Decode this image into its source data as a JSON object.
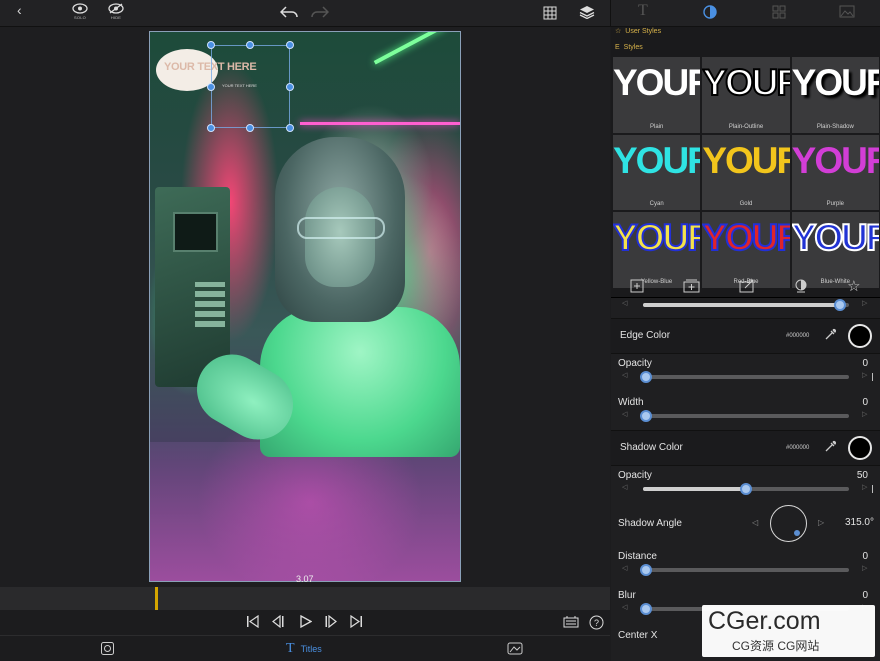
{
  "toolbar": {
    "solo_caption": "SOLO",
    "hide_caption": "HIDE",
    "icons": [
      "back-chevron-icon",
      "solo-eye-icon",
      "hide-eye-icon",
      "undo-icon",
      "redo-icon",
      "grid-icon",
      "layers-icon",
      "text-style-icon",
      "appearance-icon",
      "arrange-icon",
      "image-icon"
    ]
  },
  "canvas": {
    "title_placeholder": "YOUR TEXT HERE",
    "subtitle_placeholder": "YOUR TEXT HERE",
    "timecode": "3.07"
  },
  "bottom_bar": {
    "titles_label": "Titles"
  },
  "styles_panel": {
    "user_styles_label": "User Styles",
    "styles_label": "Styles",
    "sample_word": "YOUR",
    "presets": [
      {
        "name": "Plain",
        "fill": "#ffffff",
        "outline": "",
        "shadow": ""
      },
      {
        "name": "Plain-Outline",
        "fill": "#ffffff",
        "outline": "#000000",
        "shadow": ""
      },
      {
        "name": "Plain-Shadow",
        "fill": "#ffffff",
        "outline": "",
        "shadow": "#000000"
      },
      {
        "name": "Cyan",
        "fill": "#2fe3e3",
        "outline": "",
        "shadow": ""
      },
      {
        "name": "Gold",
        "fill": "#f2c51c",
        "outline": "",
        "shadow": ""
      },
      {
        "name": "Purple",
        "fill": "#d23ed6",
        "outline": "",
        "shadow": ""
      },
      {
        "name": "Yellow-Blue",
        "fill": "#f4e24a",
        "outline": "#2230d8",
        "shadow": ""
      },
      {
        "name": "Red-Blue",
        "fill": "#e0242a",
        "outline": "#2230d8",
        "shadow": ""
      },
      {
        "name": "Blue-White",
        "fill": "#2133d4",
        "outline": "#ffffff",
        "shadow": ""
      }
    ]
  },
  "properties": {
    "top_slider_value": 0.97,
    "edge_color_label": "Edge Color",
    "edge_color_hex": "#000000",
    "edge_opacity_label": "Opacity",
    "edge_opacity_value": "0",
    "edge_opacity_fraction": 0.0,
    "width_label": "Width",
    "width_value": "0",
    "width_fraction": 0.0,
    "shadow_color_label": "Shadow Color",
    "shadow_color_hex": "#000000",
    "shadow_opacity_label": "Opacity",
    "shadow_opacity_value": "50",
    "shadow_opacity_fraction": 0.5,
    "shadow_angle_label": "Shadow Angle",
    "shadow_angle_value": "315.0°",
    "distance_label": "Distance",
    "distance_value": "0",
    "distance_fraction": 0.0,
    "blur_label": "Blur",
    "blur_value": "0",
    "blur_fraction": 0.0,
    "center_x_label": "Center X"
  },
  "watermark": {
    "main": "CGer.com",
    "sub": "CG资源 CG网站"
  },
  "colors": {
    "accent": "#4a90e2",
    "playhead": "#d4a500",
    "section_label": "#d7b24a"
  }
}
